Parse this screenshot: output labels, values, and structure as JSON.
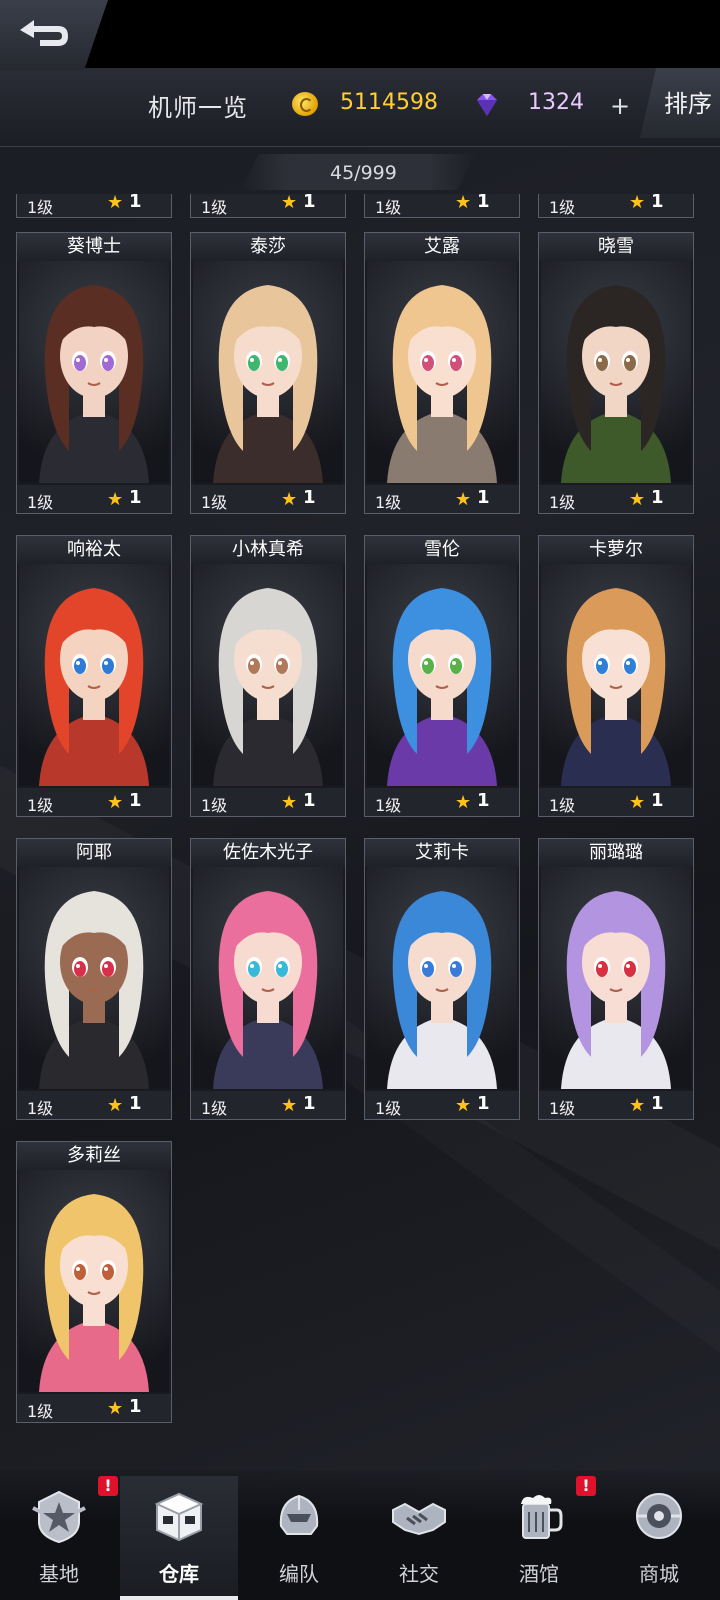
{
  "header": {
    "title": "机师一览",
    "gold": "5114598",
    "gems": "1324",
    "plus": "+",
    "sort_label": "排序",
    "count": "45/999"
  },
  "partial_row": [
    {
      "level": "1级",
      "stars": "1"
    },
    {
      "level": "1级",
      "stars": "1"
    },
    {
      "level": "1级",
      "stars": "1"
    },
    {
      "level": "1级",
      "stars": "1"
    }
  ],
  "pilots": [
    {
      "name": "葵博士",
      "level": "1级",
      "stars": "1",
      "hair": "#5a2e22",
      "skin": "#f2d3c3",
      "eyes": "#a06ad2",
      "outfit": "#2b2b33"
    },
    {
      "name": "泰莎",
      "level": "1级",
      "stars": "1",
      "hair": "#e8c59a",
      "skin": "#f6dccd",
      "eyes": "#3fb66e",
      "outfit": "#3a2d2b"
    },
    {
      "name": "艾露",
      "level": "1级",
      "stars": "1",
      "hair": "#f0c690",
      "skin": "#f8dfd0",
      "eyes": "#d0507a",
      "outfit": "#8a7b70"
    },
    {
      "name": "晓雪",
      "level": "1级",
      "stars": "1",
      "hair": "#2b2623",
      "skin": "#f1d6c6",
      "eyes": "#8a6a48",
      "outfit": "#3f5a2a"
    },
    {
      "name": "响裕太",
      "level": "1级",
      "stars": "1",
      "hair": "#e2452a",
      "skin": "#f4d3c0",
      "eyes": "#2e7ad6",
      "outfit": "#b8392c"
    },
    {
      "name": "小林真希",
      "level": "1级",
      "stars": "1",
      "hair": "#d8d6d2",
      "skin": "#f5ddd0",
      "eyes": "#b07a5a",
      "outfit": "#2a2a30"
    },
    {
      "name": "雪伦",
      "level": "1级",
      "stars": "1",
      "hair": "#3d8fe0",
      "skin": "#f6dbcc",
      "eyes": "#5ab14a",
      "outfit": "#6a3aa8"
    },
    {
      "name": "卡萝尔",
      "level": "1级",
      "stars": "1",
      "hair": "#d99a5a",
      "skin": "#f8e1d4",
      "eyes": "#2f7fd8",
      "outfit": "#2a2f52"
    },
    {
      "name": "阿耶",
      "level": "1级",
      "stars": "1",
      "hair": "#e6e2dc",
      "skin": "#9a6a52",
      "eyes": "#d8304a",
      "outfit": "#2a2a2e"
    },
    {
      "name": "佐佐木光子",
      "level": "1级",
      "stars": "1",
      "hair": "#ea6f9c",
      "skin": "#f7dbd0",
      "eyes": "#3ab8d8",
      "outfit": "#3a3a5a"
    },
    {
      "name": "艾莉卡",
      "level": "1级",
      "stars": "1",
      "hair": "#3b87d8",
      "skin": "#f6dccf",
      "eyes": "#3a7ad8",
      "outfit": "#e8e8ee"
    },
    {
      "name": "丽璐璐",
      "level": "1级",
      "stars": "1",
      "hair": "#b394e0",
      "skin": "#f7ddd3",
      "eyes": "#d83040",
      "outfit": "#e8e8ee"
    },
    {
      "name": "多莉丝",
      "level": "1级",
      "stars": "1",
      "hair": "#f0c46a",
      "skin": "#f8dfd1",
      "eyes": "#c0603a",
      "outfit": "#e86a8a"
    }
  ],
  "nav": [
    {
      "label": "基地",
      "icon": "base-icon",
      "badge": "!"
    },
    {
      "label": "仓库",
      "icon": "warehouse-icon",
      "badge": ""
    },
    {
      "label": "编队",
      "icon": "formation-icon",
      "badge": ""
    },
    {
      "label": "社交",
      "icon": "social-icon",
      "badge": ""
    },
    {
      "label": "酒馆",
      "icon": "tavern-icon",
      "badge": "!"
    },
    {
      "label": "商城",
      "icon": "shop-icon",
      "badge": ""
    }
  ],
  "colors": {
    "gold": "#ffcf33",
    "star": "#ffc21a",
    "badge": "#e0122b"
  }
}
